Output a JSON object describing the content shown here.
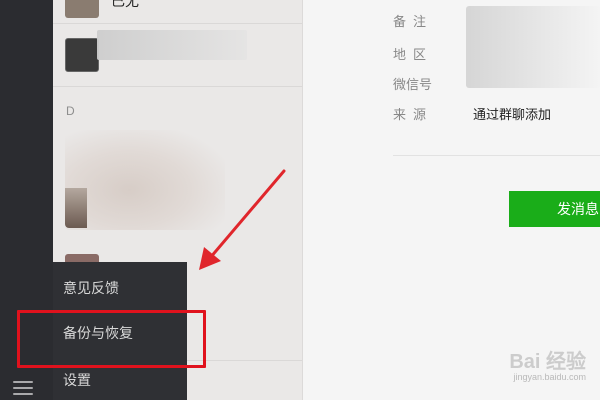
{
  "contacts": {
    "top_name_partial": "已无",
    "section_letter": "D"
  },
  "popup_menu": {
    "items": [
      {
        "label": "意见反馈"
      },
      {
        "label": "备份与恢复"
      },
      {
        "label": "设置"
      }
    ],
    "highlighted_item": "备份与恢复"
  },
  "detail": {
    "labels": {
      "remark": "备注",
      "region": "地区",
      "wechat_id": "微信号",
      "source": "来源"
    },
    "source_value": "通过群聊添加",
    "send_button": "发消息"
  },
  "watermark": {
    "logo": "Bai 经验",
    "url": "jingyan.baidu.com"
  },
  "colors": {
    "sidebar": "#2b2c30",
    "popup": "#2f3034",
    "send_button": "#1aad19",
    "highlight_box": "#e0121d",
    "arrow": "#e0262c"
  },
  "icons": [
    "menu-icon"
  ]
}
